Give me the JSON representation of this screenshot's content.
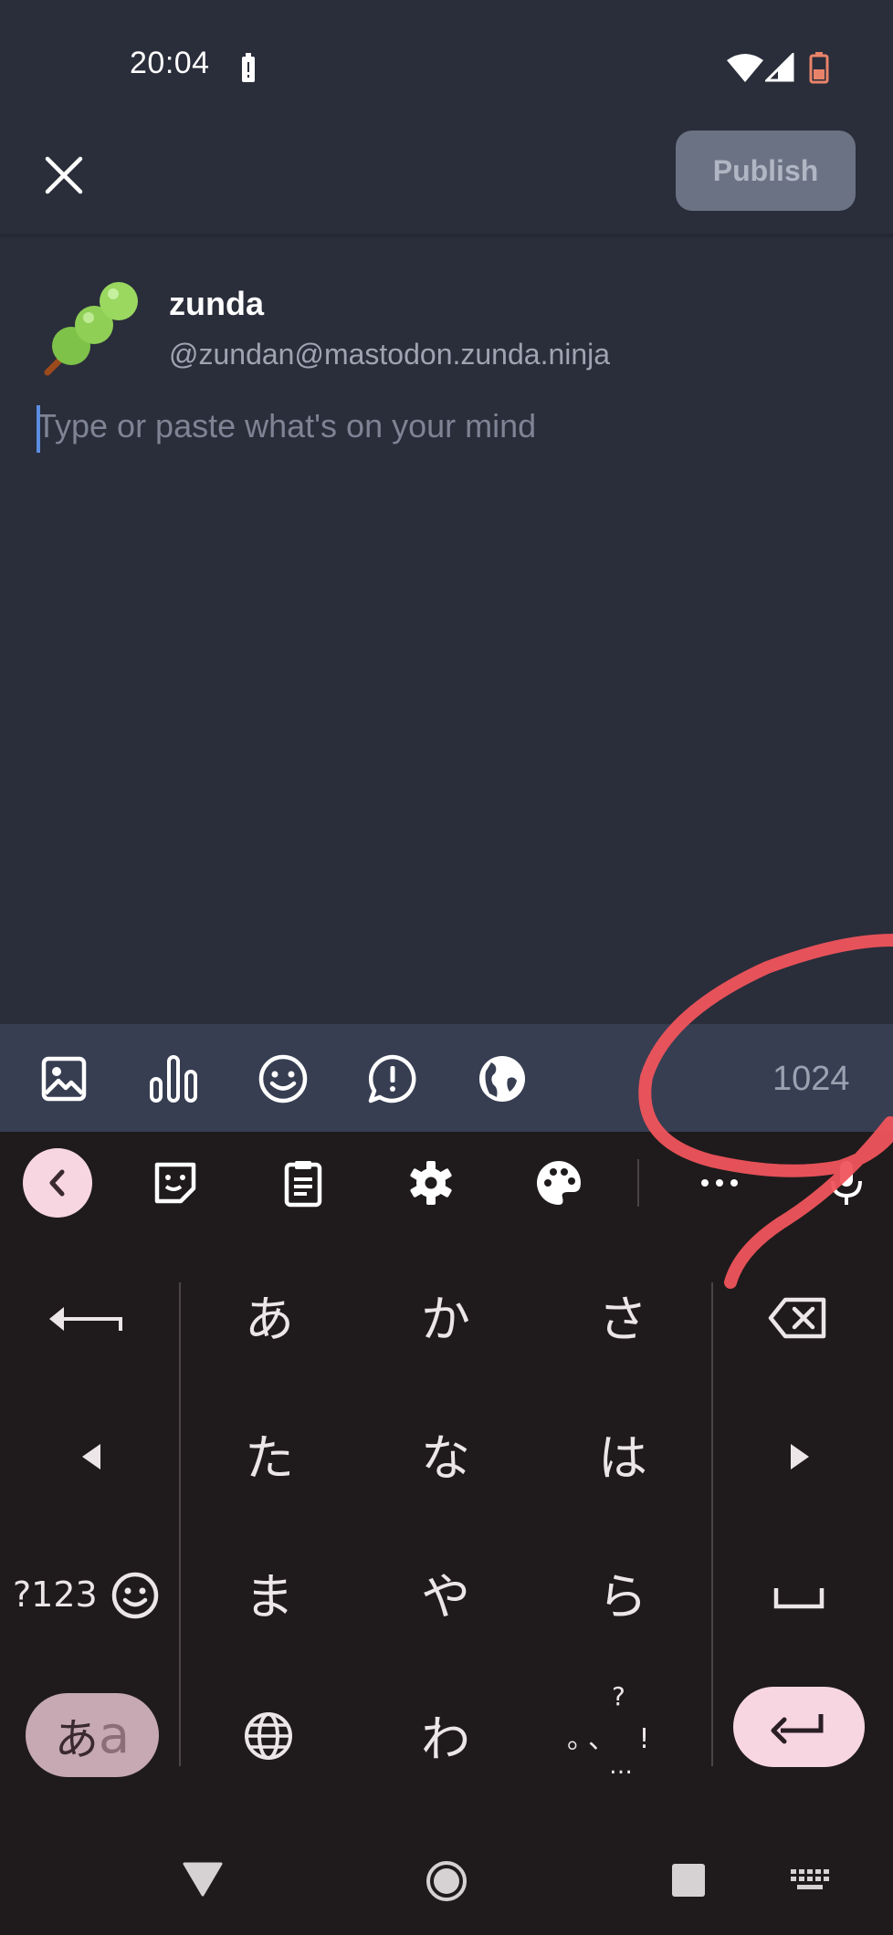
{
  "status_bar": {
    "time": "20:04"
  },
  "header": {
    "publish_label": "Publish"
  },
  "account": {
    "display_name": "zunda",
    "handle": "@zundan@mastodon.zunda.ninja"
  },
  "compose": {
    "placeholder": "Type or paste what's on your mind",
    "char_count": "1024"
  },
  "keyboard": {
    "rows": [
      [
        "あ",
        "か",
        "さ"
      ],
      [
        "た",
        "な",
        "は"
      ],
      [
        "ま",
        "や",
        "ら"
      ],
      [
        "",
        "わ",
        ""
      ]
    ],
    "mode_label_1": "あ",
    "mode_label_2": "a",
    "symbols_label": "?123",
    "punct_top": "?",
    "punct_mid": "。、 !",
    "punct_bottom": "…"
  },
  "annotation_color": "#f0545c"
}
